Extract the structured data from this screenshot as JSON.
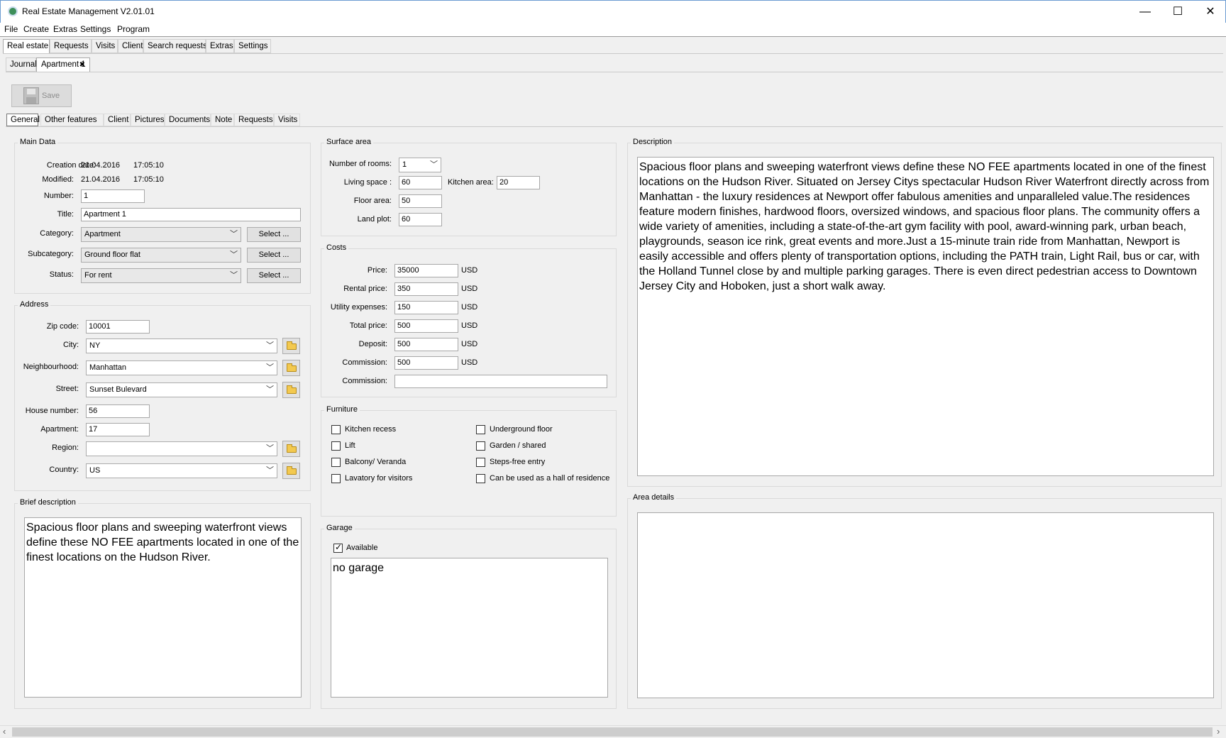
{
  "window": {
    "title": "Real Estate Management V2.01.01",
    "controls": {
      "minimize": "—",
      "maximize": "☐",
      "close": "✕"
    }
  },
  "menu": [
    "File",
    "Create",
    "Extras",
    "Settings",
    "Program"
  ],
  "main_tabs": [
    "Real estate",
    "Requests",
    "Visits",
    "Client",
    "Search requests",
    "Extras",
    "Settings"
  ],
  "doc_tabs": {
    "journal": "Journal",
    "apartment": "Apartment 1",
    "close": "✖"
  },
  "toolbar": {
    "save": "Save"
  },
  "section_tabs": [
    "General",
    "Other features",
    "Client",
    "Pictures",
    "Documents",
    "Note",
    "Requests",
    "Visits"
  ],
  "main_data": {
    "title": "Main Data",
    "creation_label": "Creation date:",
    "creation_date": "21.04.2016",
    "creation_time": "17:05:10",
    "modified_label": "Modified:",
    "modified_date": "21.04.2016",
    "modified_time": "17:05:10",
    "number_label": "Number:",
    "number": "1",
    "title_label": "Title:",
    "title_value": "Apartment 1",
    "category_label": "Category:",
    "category": "Apartment",
    "subcategory_label": "Subcategory:",
    "subcategory": "Ground floor flat",
    "status_label": "Status:",
    "status": "For rent",
    "select_button": "Select ..."
  },
  "address": {
    "title": "Address",
    "zip_label": "Zip code:",
    "zip": "10001",
    "city_label": "City:",
    "city": "NY",
    "neigh_label": "Neighbourhood:",
    "neigh": "Manhattan",
    "street_label": "Street:",
    "street": "Sunset Bulevard",
    "house_label": "House number:",
    "house": "56",
    "apt_label": "Apartment:",
    "apt": "17",
    "region_label": "Region:",
    "region": "",
    "country_label": "Country:",
    "country": "US"
  },
  "brief": {
    "title": "Brief description",
    "text": "Spacious floor plans and sweeping waterfront views define these NO FEE apartments located in one of the finest locations on the Hudson River."
  },
  "surface": {
    "title": "Surface area",
    "rooms_label": "Number of rooms:",
    "rooms": "1",
    "living_label": "Living space :",
    "living": "60",
    "kitchen_label": "Kitchen area:",
    "kitchen": "20",
    "floor_label": "Floor area:",
    "floor": "50",
    "land_label": "Land plot:",
    "land": "60"
  },
  "costs": {
    "title": "Costs",
    "currency": "USD",
    "price_label": "Price:",
    "price": "35000",
    "rental_label": "Rental price:",
    "rental": "350",
    "utility_label": "Utility expenses:",
    "utility": "150",
    "total_label": "Total price:",
    "total": "500",
    "deposit_label": "Deposit:",
    "deposit": "500",
    "commission_label": "Commission:",
    "commission": "500",
    "commission2_label": "Commission:",
    "commission2": ""
  },
  "furniture": {
    "title": "Furniture",
    "items": [
      {
        "label": "Kitchen recess",
        "checked": false
      },
      {
        "label": "Lift",
        "checked": false
      },
      {
        "label": "Balcony/ Veranda",
        "checked": false
      },
      {
        "label": "Lavatory for visitors",
        "checked": false
      },
      {
        "label": "Underground floor",
        "checked": false
      },
      {
        "label": "Garden / shared",
        "checked": false
      },
      {
        "label": "Steps-free entry",
        "checked": false
      },
      {
        "label": "Can be used as a hall of residence",
        "checked": false
      }
    ]
  },
  "garage": {
    "title": "Garage",
    "available_label": "Available",
    "available": true,
    "text": "no garage"
  },
  "description": {
    "title": "Description",
    "text": "Spacious floor plans and sweeping waterfront views define these NO FEE apartments located in one of the finest locations on the Hudson River. Situated on Jersey Citys spectacular Hudson River Waterfront directly across from Manhattan - the luxury residences at Newport offer fabulous amenities and unparalleled value.The residences feature modern finishes, hardwood floors, oversized windows, and spacious floor plans. The community offers a wide variety of amenities, including a state-of-the-art gym facility with pool, award-winning park, urban beach, playgrounds, season ice rink, great events and more.Just a 15-minute train ride from Manhattan, Newport is easily accessible and offers plenty of transportation options, including the PATH train, Light Rail, bus or car, with the Holland Tunnel close by and multiple parking garages. There is even direct pedestrian access to Downtown Jersey City and Hoboken, just a short walk away."
  },
  "area_details": {
    "title": "Area details",
    "text": ""
  },
  "scrollbar": {
    "left": "‹",
    "right": "›"
  }
}
